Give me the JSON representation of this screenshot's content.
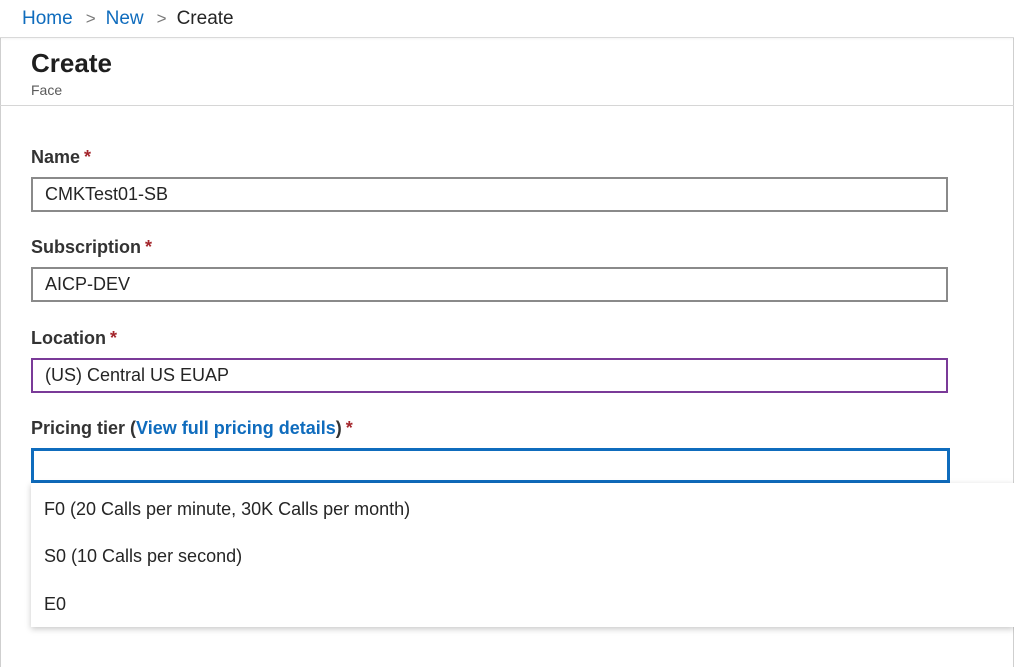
{
  "breadcrumb": {
    "home": "Home",
    "new": "New",
    "current": "Create",
    "separator": ">"
  },
  "header": {
    "title": "Create",
    "subtitle": "Face"
  },
  "form": {
    "name": {
      "label": "Name",
      "required": "*",
      "value": "CMKTest01-SB"
    },
    "subscription": {
      "label": "Subscription",
      "required": "*",
      "value": "AICP-DEV"
    },
    "location": {
      "label": "Location",
      "required": "*",
      "value": "(US) Central US EUAP"
    },
    "pricing_tier": {
      "label": "Pricing tier",
      "link_open": "(",
      "link_text": "View full pricing details",
      "link_close": ")",
      "required": "*",
      "value": "",
      "options": [
        "F0 (20 Calls per minute, 30K Calls per month)",
        "S0 (10 Calls per second)",
        "E0"
      ]
    }
  },
  "colors": {
    "link": "#0f6cbd",
    "required": "#a4262c",
    "focus_purple": "#7a3a98",
    "focus_blue": "#0f6cbd"
  }
}
